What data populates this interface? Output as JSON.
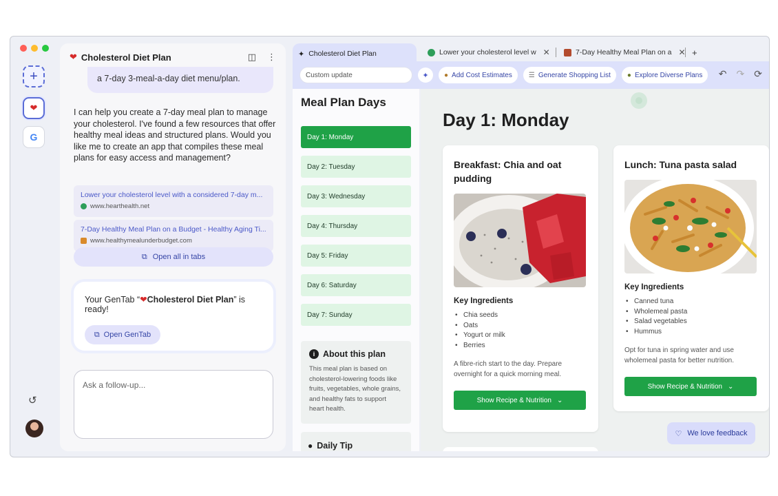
{
  "window": {
    "traffic_lights": [
      "#ff5f57",
      "#febc2e",
      "#28c840"
    ]
  },
  "rail": {
    "new_label": "+",
    "history_icon": "history-icon"
  },
  "chat": {
    "title": "Cholesterol Diet Plan",
    "user_message_tail": "a 7-day 3-meal-a-day diet menu/plan.",
    "assistant_text": "I can help you create a 7-day meal plan to manage your cholesterol. I've found a few resources that offer healthy meal ideas and structured plans. Would you like me to create an app that compiles these meal plans for easy access and management?",
    "sources": [
      {
        "title": "Lower your cholesterol level with a considered 7-day m...",
        "url": "www.hearthealth.net",
        "color": "#2e9e5a"
      },
      {
        "title": "7-Day Healthy Meal Plan on a Budget - Healthy Aging Ti...",
        "url": "www.healthymealunderbudget.com",
        "color": "#d98a2b"
      }
    ],
    "open_all_label": "Open all in tabs",
    "gentab_prefix": "Your GenTab “",
    "gentab_heart": "❤️",
    "gentab_name": "Cholesterol Diet Plan",
    "gentab_suffix": "” is ready!",
    "open_gentab_label": "Open GenTab",
    "followup_placeholder": "Ask a follow-up..."
  },
  "tabs": {
    "active": "Cholesterol Diet Plan",
    "tab2": "Lower your cholesterol level w",
    "tab3": "7-Day Healthy Meal Plan on a",
    "new_tab": "+"
  },
  "toolbar": {
    "custom_placeholder": "Custom update",
    "btn_cost": "Add Cost Estimates",
    "btn_shopping": "Generate Shopping List",
    "btn_diverse": "Explore Diverse Plans"
  },
  "sidebar": {
    "title": "Meal Plan Days",
    "days": [
      "Day 1: Monday",
      "Day 2: Tuesday",
      "Day 3: Wednesday",
      "Day 4: Thursday",
      "Day 5: Friday",
      "Day 6: Saturday",
      "Day 7: Sunday"
    ],
    "about_title": "About this plan",
    "about_text": "This meal plan is based on cholesterol-lowering foods like fruits, vegetables, whole grains, and healthy fats to support heart health.",
    "tip_title": "Daily Tip"
  },
  "main": {
    "day_title": "Day 1: Monday",
    "key_ingredients_label": "Key Ingredients",
    "recipe_button": "Show Recipe & Nutrition",
    "meals": [
      {
        "title": "Breakfast: Chia and oat pudding",
        "ingredients": [
          "Chia seeds",
          "Oats",
          "Yogurt or milk",
          "Berries"
        ],
        "desc": "A fibre-rich start to the day. Prepare overnight for a quick morning meal."
      },
      {
        "title": "Lunch: Tuna pasta salad",
        "ingredients": [
          "Canned tuna",
          "Wholemeal pasta",
          "Salad vegetables",
          "Hummus"
        ],
        "desc": "Opt for tuna in spring water and use wholemeal pasta for better nutrition."
      }
    ],
    "feedback_label": "We love feedback"
  },
  "colors": {
    "accent": "#1fa247",
    "brand": "#4a58c8",
    "day_bg": "#dff5e4"
  }
}
